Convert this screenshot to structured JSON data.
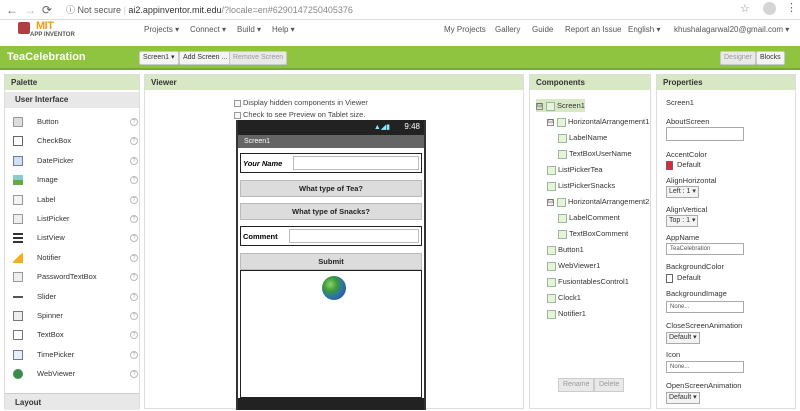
{
  "browser": {
    "not_secure": "Not secure",
    "url_host": "ai2.appinventor.mit.edu",
    "url_path": "/?locale=en#6290147250405376"
  },
  "header": {
    "logo_mit": "MIT",
    "logo_app": "APP INVENTOR",
    "menus": [
      "Projects ▾",
      "Connect ▾",
      "Build ▾",
      "Help ▾"
    ],
    "right_links": [
      "My Projects",
      "Gallery",
      "Guide",
      "Report an Issue",
      "English ▾",
      "khushalagarwal20@gmail.com ▾"
    ]
  },
  "toolbar": {
    "project_name": "TeaCelebration",
    "screen_select": "Screen1 ▾",
    "add_screen": "Add Screen ...",
    "remove_screen": "Remove Screen",
    "designer": "Designer",
    "blocks": "Blocks"
  },
  "palette": {
    "title": "Palette",
    "section": "User Interface",
    "items": [
      {
        "label": "Button",
        "icon": "button-icon"
      },
      {
        "label": "CheckBox",
        "icon": "checkbox-icon"
      },
      {
        "label": "DatePicker",
        "icon": "datepicker-icon"
      },
      {
        "label": "Image",
        "icon": "image-icon"
      },
      {
        "label": "Label",
        "icon": "label-icon"
      },
      {
        "label": "ListPicker",
        "icon": "listpicker-icon"
      },
      {
        "label": "ListView",
        "icon": "listview-icon"
      },
      {
        "label": "Notifier",
        "icon": "notifier-icon"
      },
      {
        "label": "PasswordTextBox",
        "icon": "password-icon"
      },
      {
        "label": "Slider",
        "icon": "slider-icon"
      },
      {
        "label": "Spinner",
        "icon": "spinner-icon"
      },
      {
        "label": "TextBox",
        "icon": "textbox-icon"
      },
      {
        "label": "TimePicker",
        "icon": "timepicker-icon"
      },
      {
        "label": "WebViewer",
        "icon": "webviewer-icon"
      }
    ],
    "help": "?",
    "layout_section": "Layout"
  },
  "viewer": {
    "title": "Viewer",
    "display_hidden": "Display hidden components in Viewer",
    "tablet_preview": "Check to see Preview on Tablet size.",
    "phone": {
      "time": "9:48",
      "screen_title": "Screen1",
      "your_name_label": "Your Name",
      "tea_button": "What type of Tea?",
      "snacks_button": "What type of Snacks?",
      "comment_label": "Comment",
      "submit_button": "Submit"
    }
  },
  "components": {
    "title": "Components",
    "tree": [
      {
        "label": "Screen1",
        "toggle": "⊟",
        "selected": true
      },
      {
        "label": "HorizontalArrangement1",
        "toggle": "⊟"
      },
      {
        "label": "LabelName"
      },
      {
        "label": "TextBoxUserName"
      },
      {
        "label": "ListPickerTea"
      },
      {
        "label": "ListPickerSnacks"
      },
      {
        "label": "HorizontalArrangement2",
        "toggle": "⊟"
      },
      {
        "label": "LabelComment"
      },
      {
        "label": "TextBoxComment"
      },
      {
        "label": "Button1"
      },
      {
        "label": "WebViewer1"
      },
      {
        "label": "FusiontablesControl1"
      },
      {
        "label": "Clock1"
      },
      {
        "label": "Notifier1"
      }
    ],
    "rename": "Rename",
    "delete": "Delete"
  },
  "properties": {
    "title": "Properties",
    "component": "Screen1",
    "about_screen": "AboutScreen",
    "accent_color": "AccentColor",
    "accent_value": "Default",
    "align_horizontal": "AlignHorizontal",
    "align_h_value": "Left : 1 ▾",
    "align_vertical": "AlignVertical",
    "align_v_value": "Top : 1 ▾",
    "app_name": "AppName",
    "app_name_value": "TeaCelebration",
    "background_color": "BackgroundColor",
    "background_value": "Default",
    "background_image": "BackgroundImage",
    "background_image_value": "None...",
    "close_anim": "CloseScreenAnimation",
    "close_anim_value": "Default ▾",
    "icon": "Icon",
    "icon_value": "None...",
    "open_anim": "OpenScreenAnimation",
    "open_anim_value": "Default ▾"
  },
  "colors": {
    "toolbar_green": "#8ec43f",
    "panel_header": "#d9e8c4",
    "accent_swatch": "#e8223a"
  }
}
